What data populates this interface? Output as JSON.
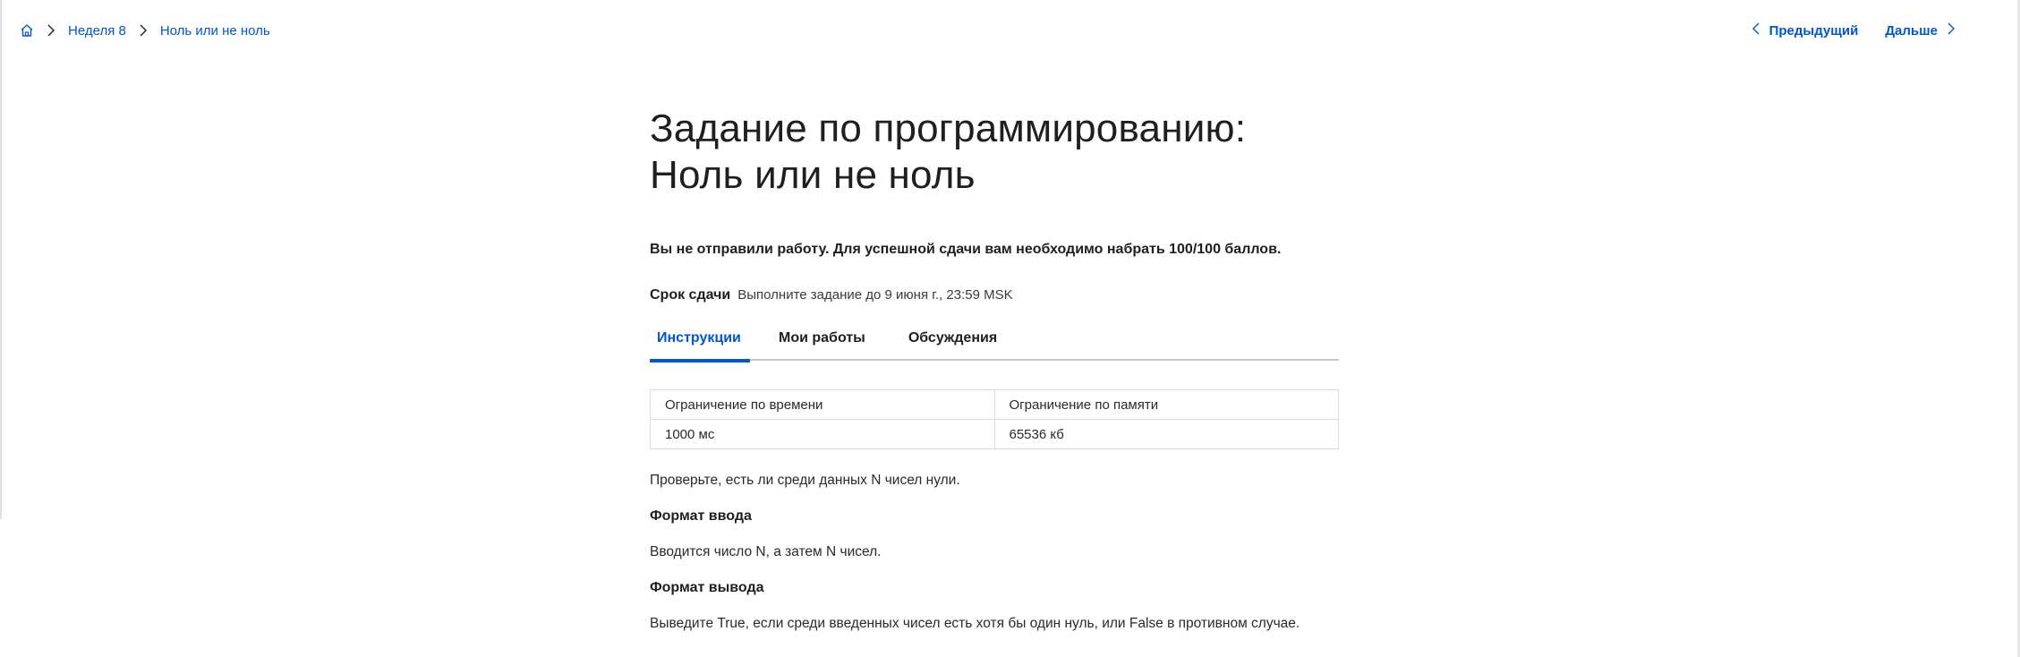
{
  "breadcrumb": {
    "home_icon": "home-icon",
    "items": [
      "Неделя 8",
      "Ноль или не ноль"
    ]
  },
  "pager": {
    "prev_label": "Предыдущий",
    "next_label": "Дальше"
  },
  "title": "Задание по программированию: Ноль или не ноль",
  "status": "Вы не отправили работу. Для успешной сдачи вам необходимо набрать 100/100 баллов.",
  "deadline": {
    "label": "Срок сдачи",
    "value": "Выполните задание до 9 июня г., 23:59 MSK"
  },
  "tabs": [
    {
      "label": "Инструкции",
      "active": true
    },
    {
      "label": "Мои работы",
      "active": false
    },
    {
      "label": "Обсуждения",
      "active": false
    }
  ],
  "limits": {
    "headers": [
      "Ограничение по времени",
      "Ограничение по памяти"
    ],
    "values": [
      "1000 мс",
      "65536 кб"
    ]
  },
  "statement": "Проверьте, есть ли среди данных N чисел нули.",
  "input_format": {
    "heading": "Формат ввода",
    "text": "Вводится число N, а затем N чисел."
  },
  "output_format": {
    "heading": "Формат вывода",
    "text": "Выведите True, если среди введенных чисел есть хотя бы один нуль, или False в противном случае."
  },
  "colors": {
    "accent": "#0056d2",
    "text": "#1f1f1f",
    "border": "#dcdcdc"
  }
}
